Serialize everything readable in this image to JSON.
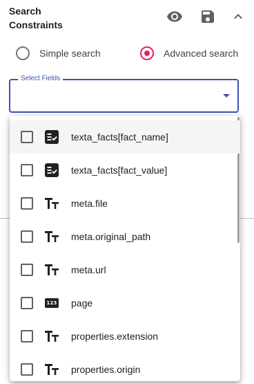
{
  "header": {
    "title": "Search Constraints",
    "icons": [
      "eye-icon",
      "save-icon",
      "chevron-up-icon"
    ]
  },
  "search_mode": {
    "options": [
      {
        "label": "Simple search",
        "checked": false
      },
      {
        "label": "Advanced search",
        "checked": true
      }
    ],
    "accent": "#e91e63"
  },
  "select_fields": {
    "label": "Select Fields",
    "value": "",
    "accent": "#3f51b5"
  },
  "dropdown": {
    "options": [
      {
        "label": "texta_facts[fact_name]",
        "icon": "fact-icon",
        "checked": false
      },
      {
        "label": "texta_facts[fact_value]",
        "icon": "fact-icon",
        "checked": false
      },
      {
        "label": "meta.file",
        "icon": "text-type-icon",
        "checked": false
      },
      {
        "label": "meta.original_path",
        "icon": "text-type-icon",
        "checked": false
      },
      {
        "label": "meta.url",
        "icon": "text-type-icon",
        "checked": false
      },
      {
        "label": "page",
        "icon": "number-icon",
        "icon_text": "123",
        "checked": false
      },
      {
        "label": "properties.extension",
        "icon": "text-type-icon",
        "checked": false
      },
      {
        "label": "properties.origin",
        "icon": "text-type-icon",
        "checked": false
      }
    ]
  }
}
